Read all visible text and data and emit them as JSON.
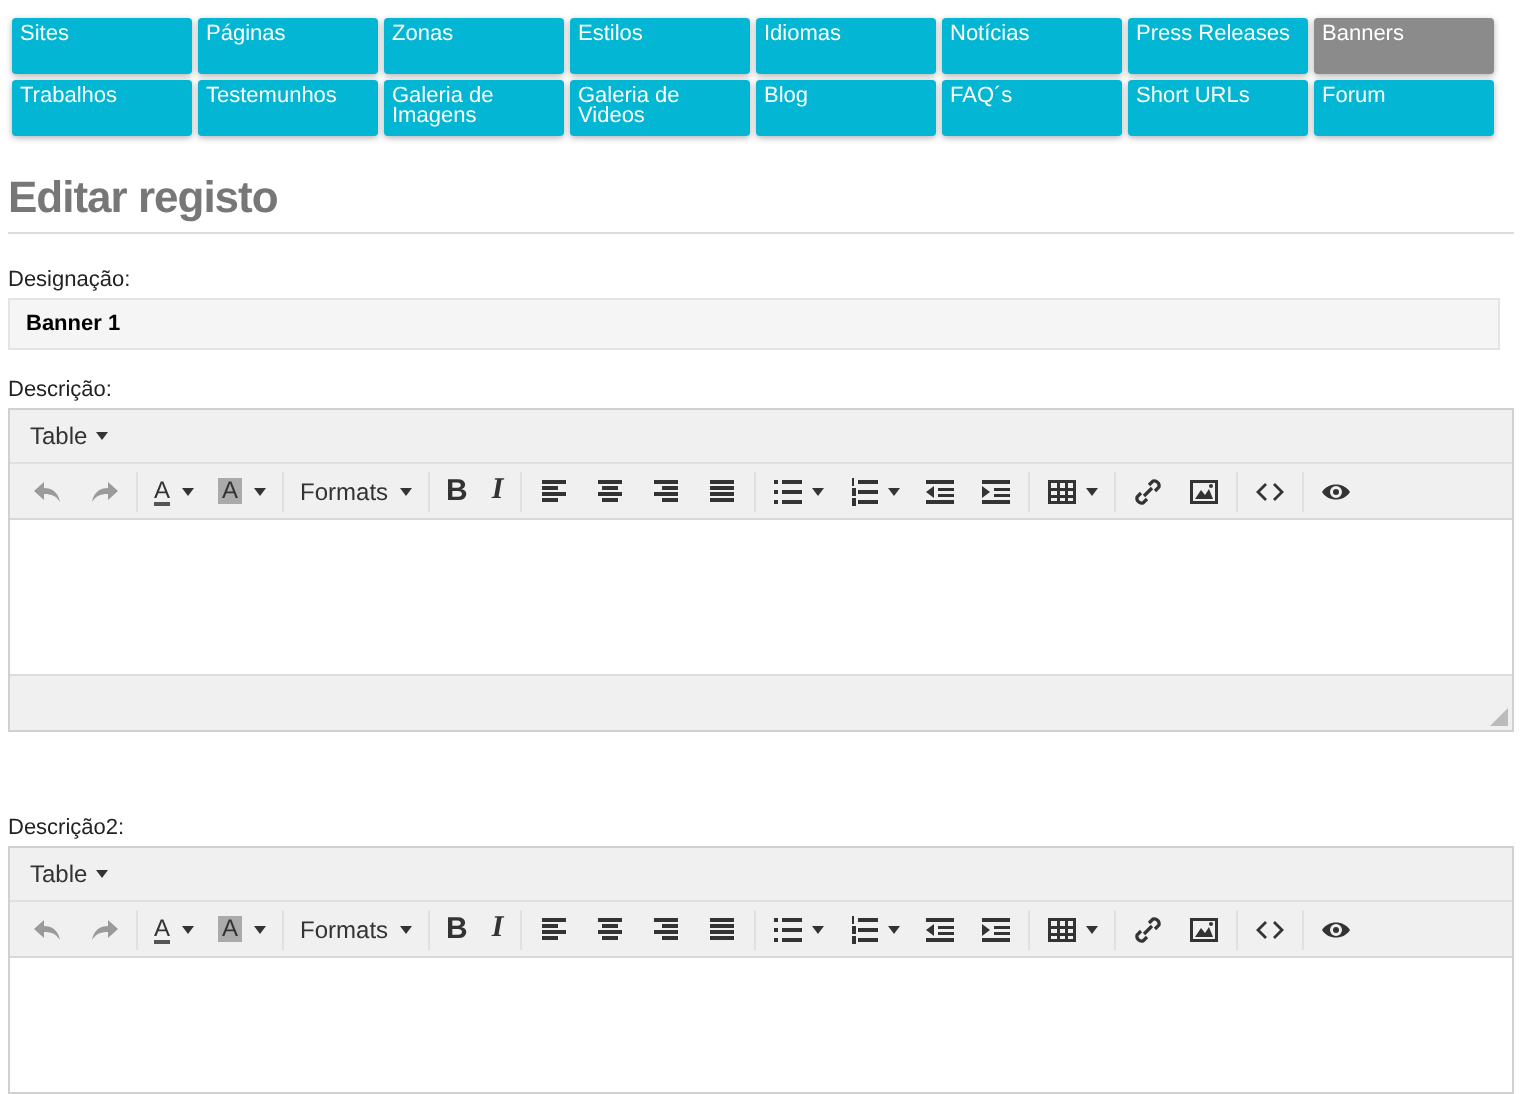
{
  "nav": [
    {
      "label": "Sites",
      "selected": false
    },
    {
      "label": "Páginas",
      "selected": false
    },
    {
      "label": "Zonas",
      "selected": false
    },
    {
      "label": "Estilos",
      "selected": false
    },
    {
      "label": "Idiomas",
      "selected": false
    },
    {
      "label": "Notícias",
      "selected": false
    },
    {
      "label": "Press Releases",
      "selected": false
    },
    {
      "label": "Banners",
      "selected": true
    },
    {
      "label": "Trabalhos",
      "selected": false
    },
    {
      "label": "Testemunhos",
      "selected": false
    },
    {
      "label": "Galeria de Imagens",
      "selected": false
    },
    {
      "label": "Galeria de Videos",
      "selected": false
    },
    {
      "label": "Blog",
      "selected": false
    },
    {
      "label": "FAQ´s",
      "selected": false
    },
    {
      "label": "Short URLs",
      "selected": false
    },
    {
      "label": "Forum",
      "selected": false
    }
  ],
  "title": "Editar registo",
  "fields": [
    {
      "label": "Designação:",
      "value": "Banner 1"
    }
  ],
  "editors": [
    {
      "label": "Descrição:",
      "menubar": [
        "Table"
      ],
      "statusbar": true,
      "toolbar": [
        [
          {
            "kind": "undo",
            "disabled": true
          },
          {
            "kind": "redo",
            "disabled": true
          }
        ],
        [
          {
            "kind": "forecolor",
            "text": "A",
            "dropdown": true
          },
          {
            "kind": "backcolor",
            "text": "A",
            "dropdown": true
          }
        ],
        [
          {
            "kind": "formats",
            "text": "Formats",
            "dropdown": true
          }
        ],
        [
          {
            "kind": "bold",
            "text": "B"
          },
          {
            "kind": "italic",
            "text": "I"
          }
        ],
        [
          {
            "kind": "alignleft"
          },
          {
            "kind": "aligncenter"
          },
          {
            "kind": "alignright"
          },
          {
            "kind": "alignjustify"
          }
        ],
        [
          {
            "kind": "bullist",
            "dropdown": true
          },
          {
            "kind": "numlist",
            "dropdown": true
          },
          {
            "kind": "outdent"
          },
          {
            "kind": "indent"
          }
        ],
        [
          {
            "kind": "table",
            "dropdown": true
          }
        ],
        [
          {
            "kind": "link"
          },
          {
            "kind": "image"
          }
        ],
        [
          {
            "kind": "code"
          }
        ],
        [
          {
            "kind": "preview"
          }
        ]
      ]
    },
    {
      "label": "Descrição2:",
      "menubar": [
        "Table"
      ],
      "statusbar": false,
      "toolbar": [
        [
          {
            "kind": "undo",
            "disabled": true
          },
          {
            "kind": "redo",
            "disabled": true
          }
        ],
        [
          {
            "kind": "forecolor",
            "text": "A",
            "dropdown": true
          },
          {
            "kind": "backcolor",
            "text": "A",
            "dropdown": true
          }
        ],
        [
          {
            "kind": "formats",
            "text": "Formats",
            "dropdown": true
          }
        ],
        [
          {
            "kind": "bold",
            "text": "B"
          },
          {
            "kind": "italic",
            "text": "I"
          }
        ],
        [
          {
            "kind": "alignleft"
          },
          {
            "kind": "aligncenter"
          },
          {
            "kind": "alignright"
          },
          {
            "kind": "alignjustify"
          }
        ],
        [
          {
            "kind": "bullist",
            "dropdown": true
          },
          {
            "kind": "numlist",
            "dropdown": true
          },
          {
            "kind": "outdent"
          },
          {
            "kind": "indent"
          }
        ],
        [
          {
            "kind": "table",
            "dropdown": true
          }
        ],
        [
          {
            "kind": "link"
          },
          {
            "kind": "image"
          }
        ],
        [
          {
            "kind": "code"
          }
        ],
        [
          {
            "kind": "preview"
          }
        ]
      ]
    }
  ]
}
